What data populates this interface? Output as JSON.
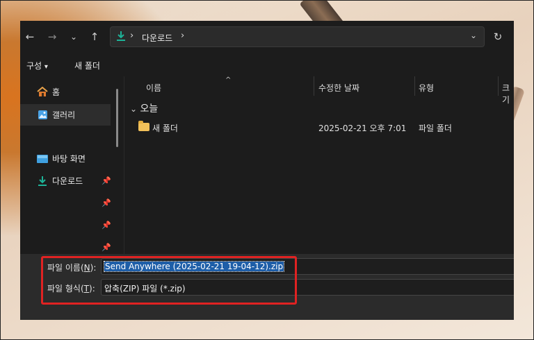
{
  "nav": {
    "back": "←",
    "forward": "→",
    "recent": "⌄",
    "up": "↑",
    "refresh": "↻"
  },
  "address": {
    "separator": "›",
    "crumb": "다운로드",
    "dropdown": "⌄"
  },
  "toolbar": {
    "organize_label": "구성",
    "organize_arrow": "▾",
    "new_folder_label": "새 폴더"
  },
  "sidebar": {
    "items": [
      {
        "label": "홈",
        "icon": "home-icon"
      },
      {
        "label": "갤러리",
        "icon": "gallery-icon"
      },
      {
        "label": "바탕 화면",
        "icon": "desktop-icon"
      },
      {
        "label": "다운로드",
        "icon": "download-icon"
      }
    ],
    "pin": "📌"
  },
  "columns": {
    "name": "이름",
    "modified": "수정한 날짜",
    "type": "유형",
    "size": "크기"
  },
  "group": {
    "chevron": "⌄",
    "label": "오늘"
  },
  "rows": [
    {
      "name": "새 폴더",
      "modified": "2025-02-21 오후 7:01",
      "type": "파일 폴더"
    }
  ],
  "filename": {
    "label_prefix": "파일 이름(",
    "label_key": "N",
    "label_suffix": "):",
    "value": "Send Anywhere (2025-02-21 19-04-12).zip"
  },
  "filetype": {
    "label_prefix": "파일 형식(",
    "label_key": "T",
    "label_suffix": "):",
    "value": "압축(ZIP) 파일 (*.zip)"
  },
  "colors": {
    "accent_download": "#1db398",
    "highlight_box": "#e02222",
    "selection": "#1e5ea8"
  }
}
